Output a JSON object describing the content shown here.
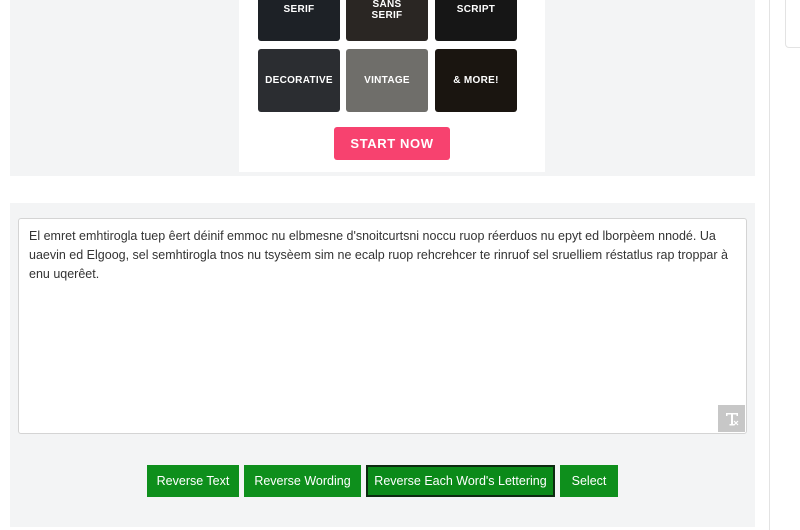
{
  "ad": {
    "tiles": [
      {
        "label": "SERIF",
        "icon": "serif-sample"
      },
      {
        "label": "SANS SERIF",
        "icon": "sans-serif-sample"
      },
      {
        "label": "SCRIPT",
        "icon": "script-sample"
      },
      {
        "label": "DECORATIVE",
        "icon": "decorative-sample"
      },
      {
        "label": "VINTAGE",
        "icon": "vintage-sample"
      },
      {
        "label": "& MORE!",
        "icon": "more-sample"
      }
    ],
    "cta_label": "START NOW",
    "cta_color": "#f7426f"
  },
  "tool": {
    "text": "El emret emhtirogla tuep êert déinif emmoc nu elbmesne d'snoitcurtsni noccu ruop réerduos nu epyt ed lborpèem nnodé. Ua uaevin ed Elgoog, sel semhtirogla tnos nu tsysèem sim ne ecalp ruop rehcrehcer te rinruof sel sruelliem réstatlus rap troppar à enu uqerêet.",
    "font_toggle_icon": "text-format-icon",
    "buttons": {
      "reverse_text": "Reverse Text",
      "reverse_wording": "Reverse Wording",
      "reverse_each_word": "Reverse Each Word's Lettering",
      "select": "Select"
    },
    "button_color": "#0e8f1c"
  }
}
